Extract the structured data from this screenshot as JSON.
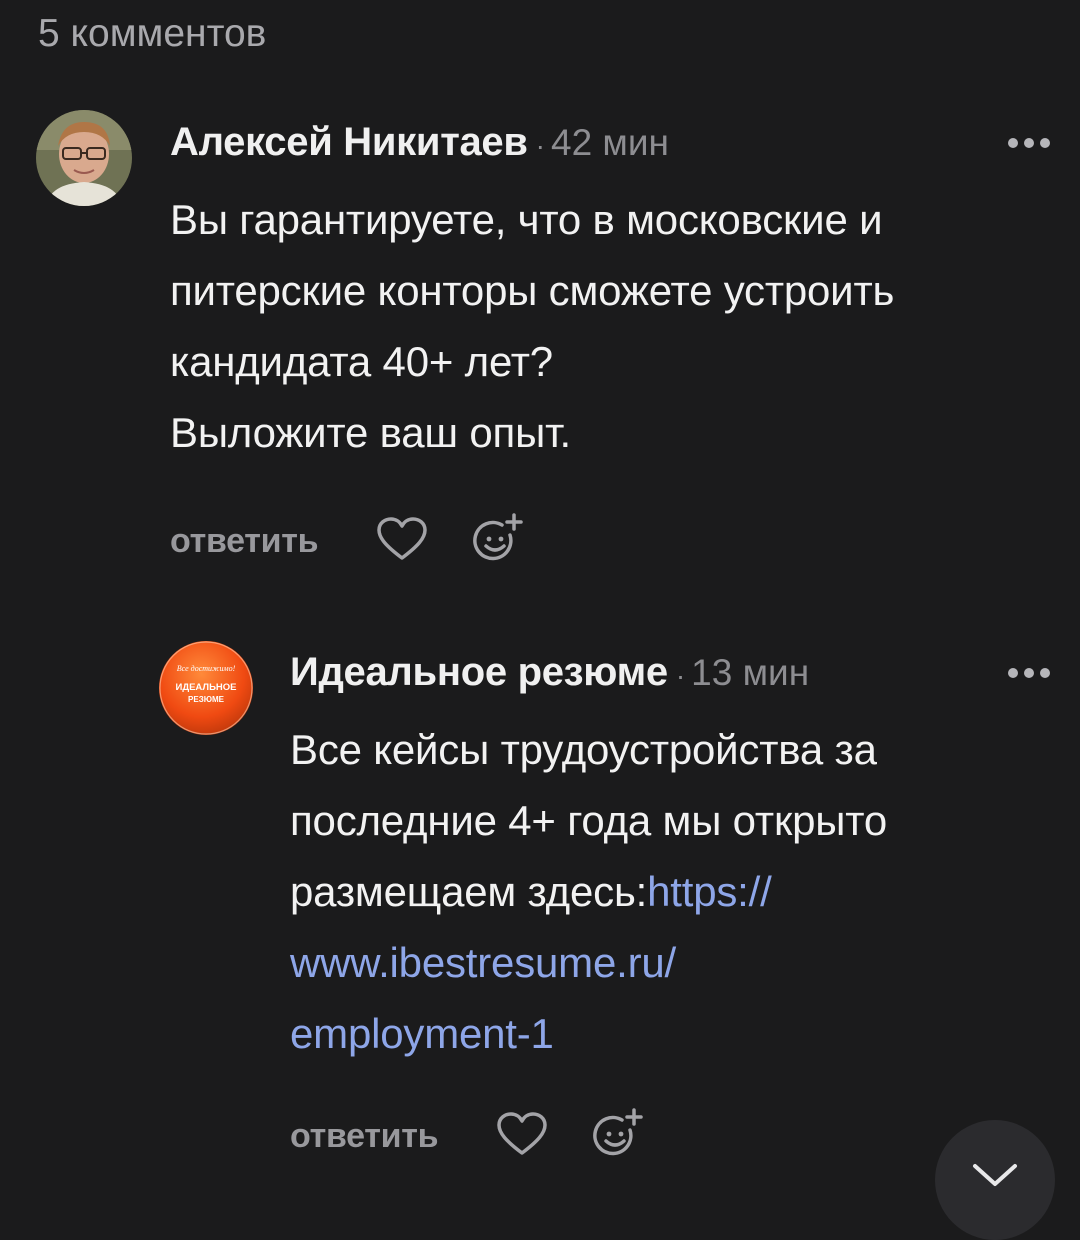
{
  "comments_count": "5 комментов",
  "comments": [
    {
      "author": "Алексей Никитаев",
      "separator": "·",
      "time": "42 мин",
      "lines": [
        "Вы гарантируете, что в московские и",
        "питерские конторы сможете устроить",
        "кандидата 40+ лет?",
        "Выложите ваш опыт."
      ],
      "reply_label": "ответить"
    },
    {
      "author": "Идеальное резюме",
      "separator": "·",
      "time": "13 мин",
      "avatar_text": {
        "top": "Все достижимо!",
        "line1": "ИДЕАЛЬНОЕ",
        "line2": "РЕЗЮМЕ"
      },
      "lines": [
        "Все кейсы трудоустройства за",
        "последние 4+ года мы открыто"
      ],
      "line3_prefix": "размещаем здесь:",
      "link_lines": [
        "https://",
        "www.ibestresume.ru/",
        "employment-1"
      ],
      "reply_label": "ответить"
    }
  ],
  "colors": {
    "background": "#1b1b1c",
    "link": "#8ea6e8",
    "muted": "#8d8d91"
  },
  "icons": [
    "more-icon",
    "heart-icon",
    "add-reaction-icon",
    "scroll-down-icon"
  ]
}
